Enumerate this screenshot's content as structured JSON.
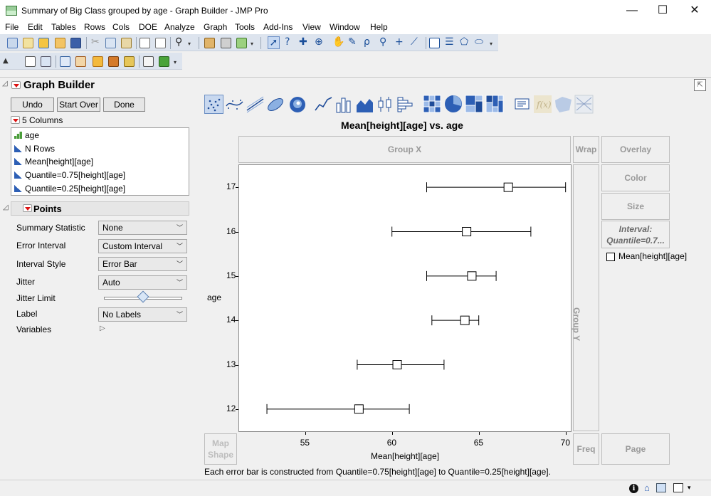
{
  "window": {
    "title": "Summary of Big Class grouped by age - Graph Builder - JMP Pro",
    "controls": [
      "—",
      "☐",
      "✕"
    ]
  },
  "menu": [
    "File",
    "Edit",
    "Tables",
    "Rows",
    "Cols",
    "DOE",
    "Analyze",
    "Graph",
    "Tools",
    "Add-Ins",
    "View",
    "Window",
    "Help"
  ],
  "graph_builder": {
    "title": "Graph Builder",
    "buttons": {
      "undo": "Undo",
      "start_over": "Start Over",
      "done": "Done"
    },
    "columns_header": "5 Columns",
    "columns": [
      {
        "name": "age",
        "kind": "ordinal"
      },
      {
        "name": "N Rows",
        "kind": "continuous"
      },
      {
        "name": "Mean[height][age]",
        "kind": "continuous"
      },
      {
        "name": "Quantile=0.75[height][age]",
        "kind": "continuous"
      },
      {
        "name": "Quantile=0.25[height][age]",
        "kind": "continuous"
      }
    ],
    "points": {
      "header": "Points",
      "options": {
        "summary_statistic": {
          "label": "Summary Statistic",
          "value": "None"
        },
        "error_interval": {
          "label": "Error Interval",
          "value": "Custom Interval"
        },
        "interval_style": {
          "label": "Interval Style",
          "value": "Error Bar"
        },
        "jitter": {
          "label": "Jitter",
          "value": "Auto"
        },
        "jitter_limit": {
          "label": "Jitter Limit",
          "level": 0.5
        },
        "label": {
          "label": "Label",
          "value": "No Labels"
        },
        "variables": {
          "label": "Variables"
        }
      }
    },
    "zones": {
      "group_x": "Group X",
      "wrap": "Wrap",
      "overlay": "Overlay",
      "color": "Color",
      "size": "Size",
      "interval": "Interval:",
      "interval_value": "Quantile=0.7...",
      "group_y": "Group Y",
      "map_shape_1": "Map",
      "map_shape_2": "Shape",
      "freq": "Freq",
      "page": "Page"
    },
    "legend_item": "Mean[height][age]",
    "footnote": "Each error bar is constructed from Quantile=0.75[height][age] to Quantile=0.25[height][age]."
  },
  "chart_data": {
    "type": "scatter",
    "title": "Mean[height][age] vs. age",
    "xlabel": "Mean[height][age]",
    "ylabel": "age",
    "xlim": [
      51.2,
      70.3
    ],
    "x_ticks": [
      55,
      60,
      65,
      70
    ],
    "categories": [
      "12",
      "13",
      "14",
      "15",
      "16",
      "17"
    ],
    "series": [
      {
        "name": "Mean[height][age]",
        "points": [
          {
            "y": "12",
            "x": 58.1,
            "low": 52.8,
            "high": 61.0
          },
          {
            "y": "13",
            "x": 60.3,
            "low": 58.0,
            "high": 63.0
          },
          {
            "y": "14",
            "x": 64.2,
            "low": 62.3,
            "high": 65.0
          },
          {
            "y": "15",
            "x": 64.6,
            "low": 62.0,
            "high": 66.0
          },
          {
            "y": "16",
            "x": 64.3,
            "low": 60.0,
            "high": 68.0
          },
          {
            "y": "17",
            "x": 66.7,
            "low": 62.0,
            "high": 70.0
          }
        ]
      }
    ],
    "grid": false,
    "legend": "right"
  }
}
